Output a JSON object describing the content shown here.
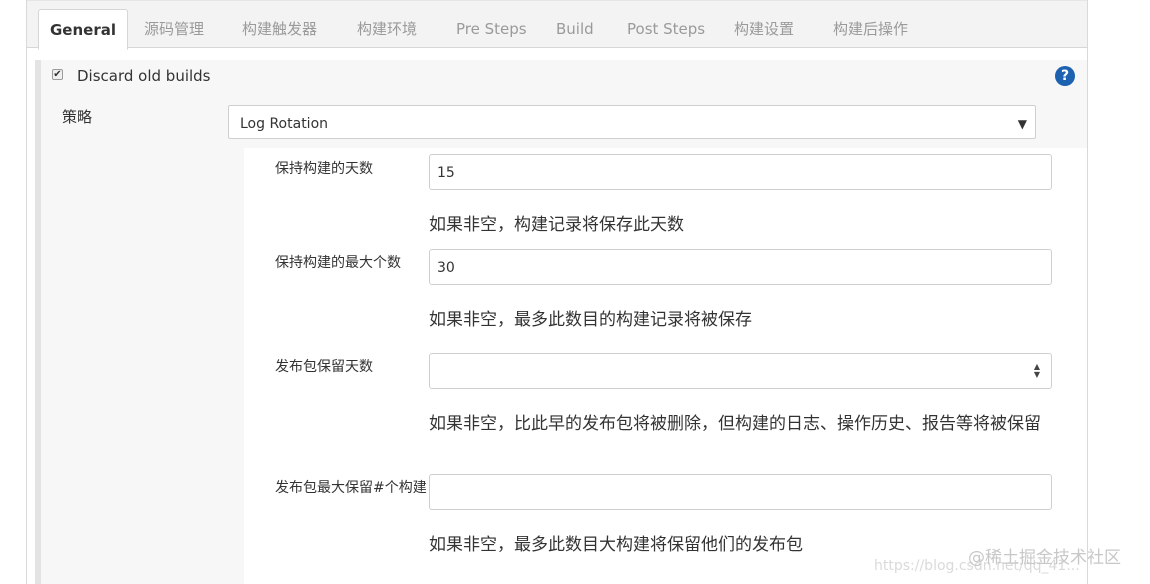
{
  "tabs": [
    {
      "label": "General",
      "active": true
    },
    {
      "label": "源码管理"
    },
    {
      "label": "构建触发器"
    },
    {
      "label": "构建环境"
    },
    {
      "label": "Pre Steps"
    },
    {
      "label": "Build"
    },
    {
      "label": "Post Steps"
    },
    {
      "label": "构建设置"
    },
    {
      "label": "构建后操作"
    }
  ],
  "discard": {
    "checked": true,
    "label": "Discard old builds",
    "help_icon": "question-circle-icon",
    "strategy_label": "策略",
    "strategy_value": "Log Rotation",
    "select_arrow": "▼"
  },
  "fields": [
    {
      "label": "保持构建的天数",
      "value": "15",
      "hint": "如果非空，构建记录将保存此天数"
    },
    {
      "label": "保持构建的最大个数",
      "value": "30",
      "hint": "如果非空，最多此数目的构建记录将被保存"
    },
    {
      "label": "发布包保留天数",
      "value": "",
      "hint": "如果非空，比此早的发布包将被删除，但构建的日志、操作历史、报告等将被保留",
      "spinner": true
    },
    {
      "label": "发布包最大保留#个构建",
      "value": "",
      "hint": "如果非空，最多此数目大构建将保留他们的发布包"
    }
  ],
  "watermark": {
    "brand": "@稀土掘金技术社区",
    "url": "https://blog.csdn.net/qq_41..."
  },
  "colors": {
    "accent": "#1c62b0",
    "panel": "#f7f7f7",
    "tabbar": "#f3f3f3"
  }
}
